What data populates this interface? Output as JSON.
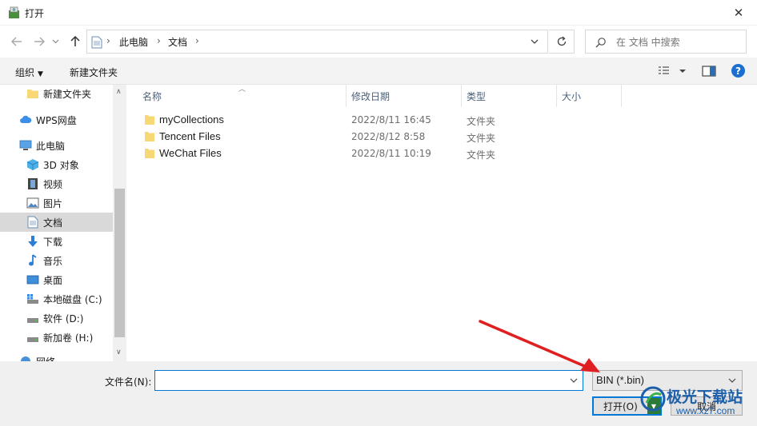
{
  "window": {
    "title": "打开",
    "close_glyph": "✕"
  },
  "nav": {
    "crumbs": [
      "此电脑",
      "文档"
    ],
    "search_placeholder": "在 文档 中搜索"
  },
  "toolbar": {
    "organize_label": "组织",
    "new_folder_label": "新建文件夹"
  },
  "sidebar": {
    "items": [
      {
        "label": "新建文件夹",
        "icon": "folder-icon"
      },
      {
        "label": "WPS网盘",
        "icon": "cloud-icon"
      },
      {
        "label": "此电脑",
        "icon": "computer-icon"
      },
      {
        "label": "3D 对象",
        "icon": "cube-icon"
      },
      {
        "label": "视频",
        "icon": "video-icon"
      },
      {
        "label": "图片",
        "icon": "picture-icon"
      },
      {
        "label": "文档",
        "icon": "document-icon",
        "selected": true
      },
      {
        "label": "下载",
        "icon": "download-icon"
      },
      {
        "label": "音乐",
        "icon": "music-icon"
      },
      {
        "label": "桌面",
        "icon": "desktop-icon"
      },
      {
        "label": "本地磁盘 (C:)",
        "icon": "drive-icon"
      },
      {
        "label": "软件 (D:)",
        "icon": "drive-icon"
      },
      {
        "label": "新加卷 (H:)",
        "icon": "drive-icon"
      },
      {
        "label": "网络",
        "icon": "network-icon"
      }
    ]
  },
  "columns": {
    "name": "名称",
    "modified": "修改日期",
    "type": "类型",
    "size": "大小"
  },
  "files": [
    {
      "name": "myCollections",
      "modified": "2022/8/11 16:45",
      "type": "文件夹"
    },
    {
      "name": "Tencent Files",
      "modified": "2022/8/12 8:58",
      "type": "文件夹"
    },
    {
      "name": "WeChat Files",
      "modified": "2022/8/11 10:19",
      "type": "文件夹"
    }
  ],
  "footer": {
    "filename_label": "文件名(N):",
    "filename_value": "",
    "filter_value": "BIN (*.bin)",
    "open_label": "打开(O)",
    "cancel_label": "取消"
  },
  "watermark": {
    "text": "极光下载站",
    "url": "www.xz7.com"
  },
  "colors": {
    "accent": "#0078d7",
    "folder": "#f8d775",
    "arrow": "#e02020",
    "selected_bg": "#d9d9d9"
  }
}
